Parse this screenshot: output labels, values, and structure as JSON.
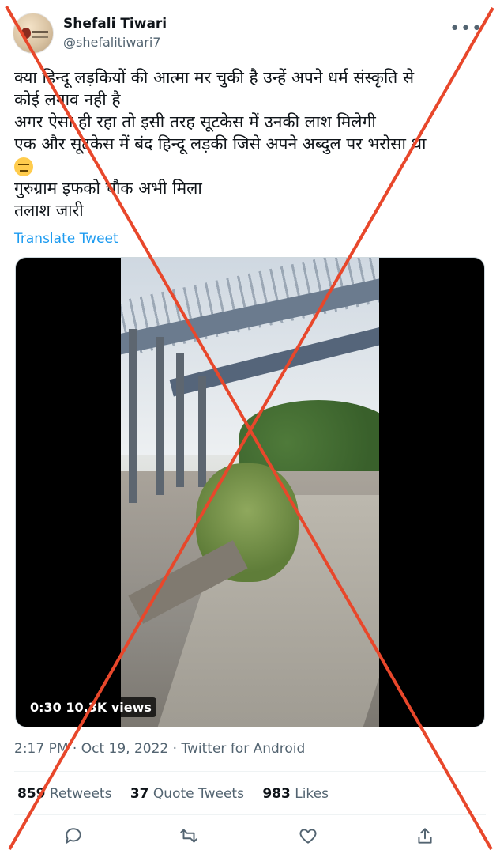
{
  "author": {
    "name": "Shefali Tiwari",
    "handle": "@shefalitiwari7"
  },
  "tweet": {
    "lines": [
      "क्या हिन्दू लड़कियों की आत्मा मर चुकी है उन्हें अपने धर्म संस्कृति से",
      "कोई लगाव नही है",
      "अगर ऐसा ही रहा तो इसी तरह सूटकेस में उनकी लाश मिलेगी",
      "एक और सूटकेस में बंद हिन्दू लड़की जिसे अपने अब्दुल पर भरोसा था",
      "गुरुग्राम इफको चौक अभी मिला",
      "तलाश जारी"
    ],
    "emoji": "expressionless-face",
    "translate_label": "Translate Tweet"
  },
  "video": {
    "duration": "0:30",
    "views": "10.3K views"
  },
  "meta": {
    "time": "2:17 PM",
    "separator": " · ",
    "date": "Oct 19, 2022",
    "source": "Twitter for Android"
  },
  "stats": {
    "retweets_count": "859",
    "retweets_label": "Retweets",
    "quotes_count": "37",
    "quotes_label": "Quote Tweets",
    "likes_count": "983",
    "likes_label": "Likes"
  },
  "icons": {
    "more": "more-icon",
    "reply": "reply-icon",
    "retweet": "retweet-icon",
    "like": "heart-icon",
    "share": "share-icon"
  },
  "colors": {
    "link": "#1d9bf0",
    "secondary": "#536471",
    "cross": "#e8472b"
  }
}
